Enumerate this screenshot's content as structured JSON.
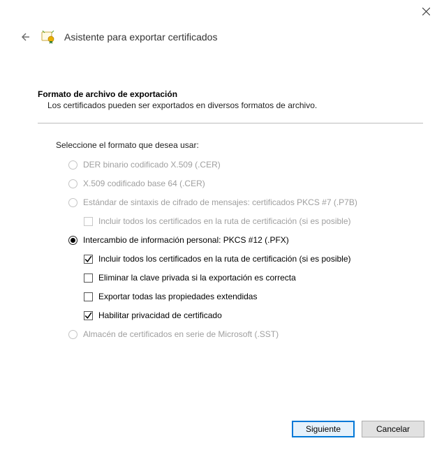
{
  "header": {
    "title": "Asistente para exportar certificados"
  },
  "section": {
    "title": "Formato de archivo de exportación",
    "description": "Los certificados pueden ser exportados en diversos formatos de archivo.",
    "prompt": "Seleccione el formato que desea usar:"
  },
  "options": [
    {
      "label": "DER binario codificado X.509 (.CER)",
      "enabled": false,
      "selected": false
    },
    {
      "label": "X.509 codificado base 64 (.CER)",
      "enabled": false,
      "selected": false
    },
    {
      "label": "Estándar de sintaxis de cifrado de mensajes: certificados PKCS #7 (.P7B)",
      "enabled": false,
      "selected": false,
      "sub": [
        {
          "label": "Incluir todos los certificados en la ruta de certificación (si es posible)",
          "checked": false,
          "enabled": false
        }
      ]
    },
    {
      "label": "Intercambio de información personal: PKCS #12 (.PFX)",
      "enabled": true,
      "selected": true,
      "sub": [
        {
          "label": "Incluir todos los certificados en la ruta de certificación (si es posible)",
          "checked": true,
          "enabled": true
        },
        {
          "label": "Eliminar la clave privada si la exportación es correcta",
          "checked": false,
          "enabled": true
        },
        {
          "label": "Exportar todas las propiedades extendidas",
          "checked": false,
          "enabled": true
        },
        {
          "label": "Habilitar privacidad de certificado",
          "checked": true,
          "enabled": true
        }
      ]
    },
    {
      "label": "Almacén de certificados en serie de Microsoft (.SST)",
      "enabled": false,
      "selected": false
    }
  ],
  "buttons": {
    "next": "Siguiente",
    "cancel": "Cancelar"
  }
}
